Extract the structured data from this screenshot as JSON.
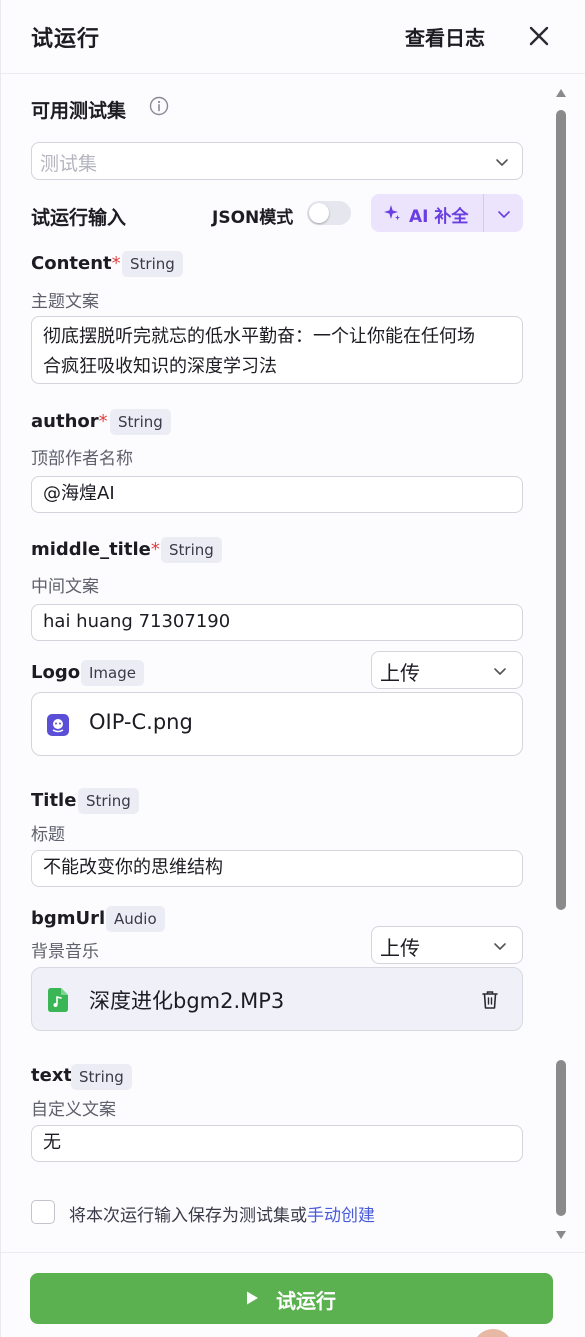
{
  "header": {
    "title": "试运行",
    "view_log": "查看日志"
  },
  "testset": {
    "label": "可用测试集",
    "placeholder": "测试集"
  },
  "run_input": {
    "label": "试运行输入",
    "json_mode_label": "JSON模式",
    "json_mode_on": false,
    "ai_fill_label": "AI 补全",
    "accent": "#6a3ee0"
  },
  "fields": {
    "content": {
      "name": "Content",
      "type": "String",
      "desc": "主题文案",
      "value_line1": "彻底摆脱听完就忘的低水平勤奋：一个让你能在任何场",
      "value_line2": "合疯狂吸收知识的深度学习法"
    },
    "author": {
      "name": "author",
      "type": "String",
      "desc": "顶部作者名称",
      "value": "@海煌AI"
    },
    "middle_title": {
      "name": "middle_title",
      "type": "String",
      "desc": "中间文案",
      "value": "hai huang  71307190"
    },
    "logo": {
      "name": "Logo",
      "type": "Image",
      "upload_mode": "上传",
      "file_name": "OIP-C.png"
    },
    "title": {
      "name": "Title",
      "type": "String",
      "desc": "标题",
      "value": "不能改变你的思维结构"
    },
    "bgm": {
      "name": "bgmUrl",
      "type": "Audio",
      "desc": "背景音乐",
      "upload_mode": "上传",
      "file_name": "深度进化bgm2.MP3"
    },
    "text": {
      "name": "text",
      "type": "String",
      "desc": "自定义文案",
      "value": "无"
    }
  },
  "required_mark": "*",
  "save_option": {
    "text": "将本次运行输入保存为测试集或",
    "link": "手动创建",
    "checked": false
  },
  "footer": {
    "run_label": "试运行",
    "color": "#5bb050"
  }
}
